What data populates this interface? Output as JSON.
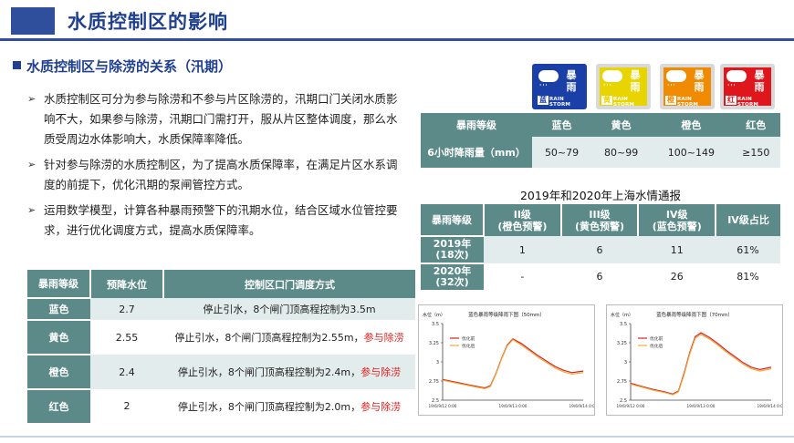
{
  "title": "水质控制区的影响",
  "section_heading": "水质控制区与除涝的关系（汛期）",
  "bullets": [
    "水质控制区可分为参与除涝和不参与片区除涝的，汛期口门关闭水质影响不大，如果参与除涝，汛期口门需打开，服从片区整体调度，那么水质受周边水体影响大，水质保障率降低。",
    "针对参与除涝的水质控制区，为了提高水质保障率，在满足片区水系调度的前提下，优化汛期的泵闸管控方式。",
    "运用数学模型，计算各种暴雨预警下的汛期水位，结合区域水位管控要求，进行优化调度方式，提高水质保障率。"
  ],
  "left_table": {
    "headers": [
      "暴雨等级",
      "预降水位",
      "控制区口门调度方式"
    ],
    "rows": [
      {
        "level": "蓝色",
        "water": "2.7",
        "method": "停止引水，8个闸门顶高程控制为3.5m",
        "extra": ""
      },
      {
        "level": "黄色",
        "water": "2.55",
        "method": "停止引水，8个闸门顶高程控制为2.55m，",
        "extra": "参与除涝"
      },
      {
        "level": "橙色",
        "water": "2.4",
        "method": "停止引水，8个闸门顶高程控制为2.4m，",
        "extra": "参与除涝"
      },
      {
        "level": "红色",
        "water": "2",
        "method": "停止引水，8个闸门顶高程控制为2.0m，",
        "extra": "参与除涝"
      }
    ]
  },
  "storm_icons": [
    {
      "cn": "暴雨",
      "lvl": "蓝",
      "en": "RAIN STORM",
      "bg": "#1a3fa6",
      "frame": "#1a3fa6"
    },
    {
      "cn": "暴雨",
      "lvl": "黄",
      "en": "RAIN STORM",
      "bg": "#e8d400",
      "frame": "#d9d9d9"
    },
    {
      "cn": "暴雨",
      "lvl": "橙",
      "en": "RAIN STORM",
      "bg": "#f08a00",
      "frame": "#d9d9d9"
    },
    {
      "cn": "暴雨",
      "lvl": "红",
      "en": "RAIN STORM",
      "bg": "#e0161d",
      "frame": "#d9d9d9"
    }
  ],
  "rain_table": {
    "header": [
      "暴雨等级",
      "蓝色",
      "黄色",
      "橙色",
      "红色"
    ],
    "row_label": "6小时降雨量（mm）",
    "values": [
      "50~79",
      "80~99",
      "100~149",
      "≥150"
    ]
  },
  "history_title": "2019年和2020年上海水情通报",
  "history_table": {
    "headers": [
      {
        "l1": "暴雨等级",
        "l2": ""
      },
      {
        "l1": "II级",
        "l2": "(橙色预警)"
      },
      {
        "l1": "III级",
        "l2": "(黄色预警)"
      },
      {
        "l1": "IV级",
        "l2": "(蓝色预警)"
      },
      {
        "l1": "IV级占比",
        "l2": ""
      }
    ],
    "rows": [
      {
        "y1": "2019年",
        "y2": "(18次)",
        "c": [
          "1",
          "6",
          "11",
          "61%"
        ]
      },
      {
        "y1": "2020年",
        "y2": "(32次)",
        "c": [
          "-",
          "6",
          "26",
          "81%"
        ]
      }
    ]
  },
  "charts": [
    {
      "chart_data": {
        "type": "line",
        "title": "蓝色暴雨等级降雨下图（50mm）",
        "ylabel": "水位（m）",
        "ylim": [
          2.5,
          3.5
        ],
        "yticks": [
          "3.5",
          "3.25",
          "3",
          "2.75",
          "2.5"
        ],
        "xticks": [
          "19/6/9/12 0:00",
          "19/6/9/13 0:00",
          "19/6/9/14 0:00"
        ],
        "legend": [
          "优化前",
          "优化后"
        ],
        "series": [
          {
            "name": "优化前",
            "color": "#d62020",
            "x": [
              0,
              0.08,
              0.16,
              0.24,
              0.3,
              0.34,
              0.38,
              0.42,
              0.46,
              0.5,
              0.56,
              0.62,
              0.68,
              0.74,
              0.8,
              0.86,
              0.92,
              1.0
            ],
            "y": [
              2.77,
              2.74,
              2.71,
              2.68,
              2.66,
              2.69,
              2.85,
              3.05,
              3.22,
              3.3,
              3.24,
              3.16,
              3.08,
              3.01,
              2.94,
              2.89,
              2.86,
              2.88
            ]
          },
          {
            "name": "优化后",
            "color": "#f2a93b",
            "x": [
              0,
              0.08,
              0.16,
              0.24,
              0.3,
              0.34,
              0.38,
              0.42,
              0.46,
              0.5,
              0.56,
              0.62,
              0.68,
              0.74,
              0.8,
              0.86,
              0.92,
              1.0
            ],
            "y": [
              2.76,
              2.73,
              2.7,
              2.67,
              2.65,
              2.68,
              2.84,
              3.04,
              3.21,
              3.29,
              3.22,
              3.14,
              3.06,
              2.99,
              2.92,
              2.87,
              2.84,
              2.86
            ]
          }
        ]
      }
    },
    {
      "chart_data": {
        "type": "line",
        "title": "蓝色暴雨等级降雨下图（70mm）",
        "ylabel": "水位（m）",
        "ylim": [
          2.5,
          3.5
        ],
        "yticks": [
          "3.5",
          "3.25",
          "3",
          "2.75",
          "2.5"
        ],
        "xticks": [
          "19/6/9/12 0:00",
          "19/6/9/13 0:00",
          "19/6/9/14 0:00"
        ],
        "legend": [
          "优化前",
          "优化后"
        ],
        "series": [
          {
            "name": "优化前",
            "color": "#d62020",
            "x": [
              0,
              0.08,
              0.16,
              0.24,
              0.3,
              0.34,
              0.38,
              0.42,
              0.46,
              0.5,
              0.56,
              0.62,
              0.68,
              0.74,
              0.8,
              0.86,
              0.92,
              1.0
            ],
            "y": [
              2.72,
              2.68,
              2.64,
              2.61,
              2.58,
              2.62,
              2.85,
              3.12,
              3.33,
              3.38,
              3.32,
              3.24,
              3.15,
              3.07,
              2.99,
              2.93,
              2.9,
              2.93
            ]
          },
          {
            "name": "优化后",
            "color": "#f2a93b",
            "x": [
              0,
              0.08,
              0.16,
              0.24,
              0.3,
              0.34,
              0.38,
              0.42,
              0.46,
              0.5,
              0.56,
              0.62,
              0.68,
              0.74,
              0.8,
              0.86,
              0.92,
              1.0
            ],
            "y": [
              2.71,
              2.67,
              2.63,
              2.6,
              2.57,
              2.61,
              2.83,
              3.1,
              3.31,
              3.36,
              3.3,
              3.22,
              3.13,
              3.05,
              2.97,
              2.91,
              2.88,
              2.91
            ]
          }
        ]
      }
    }
  ]
}
